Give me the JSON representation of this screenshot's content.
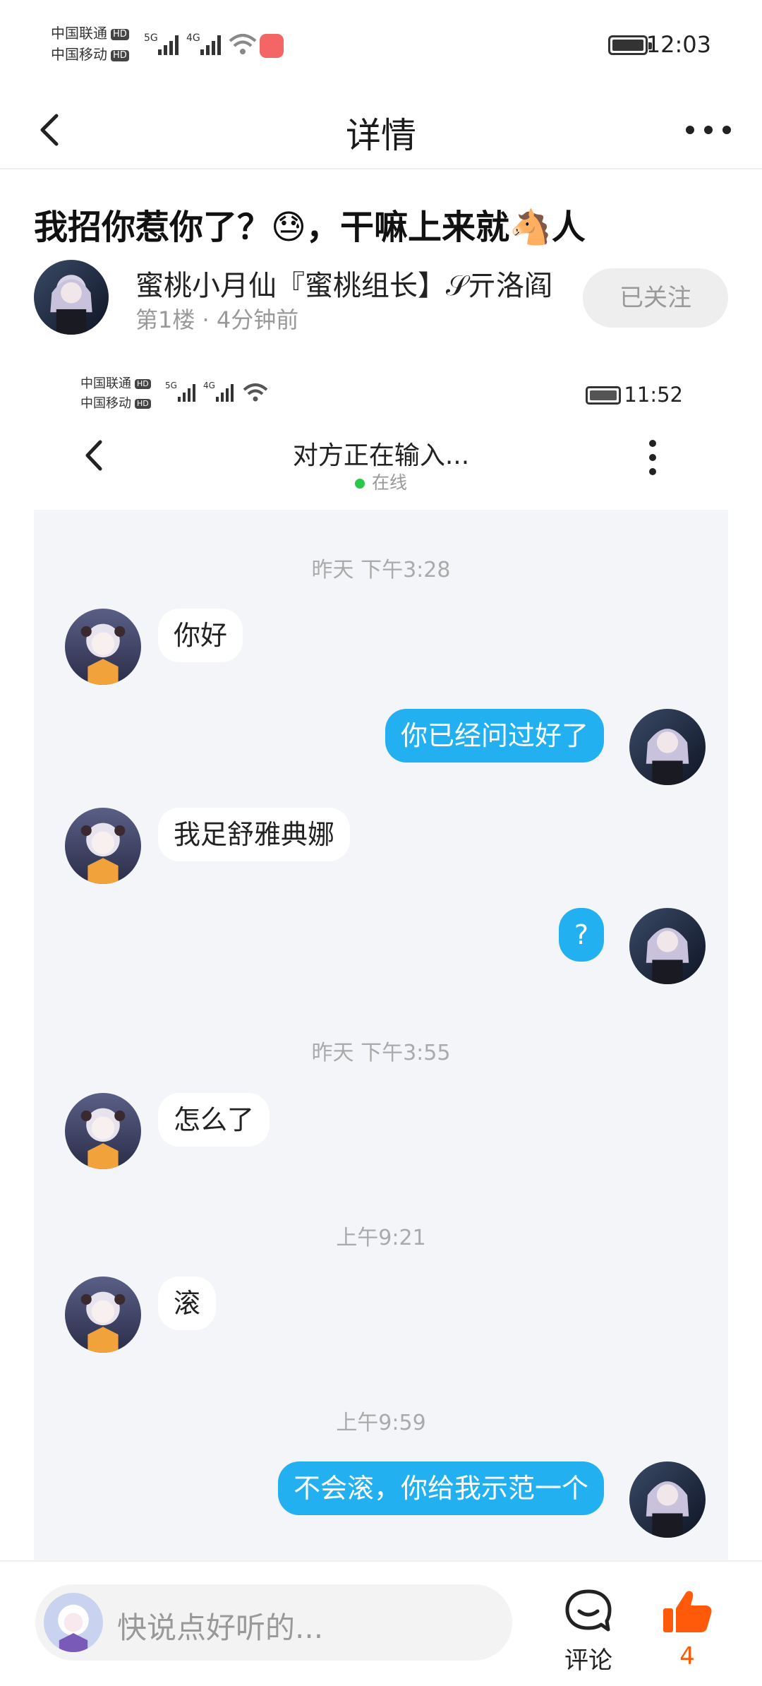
{
  "status_bar": {
    "carrier1": "中国联通",
    "carrier2": "中国移动",
    "hd": "HD",
    "net1": "5G",
    "net2": "4G",
    "time": "12:03"
  },
  "nav": {
    "title": "详情"
  },
  "post": {
    "title": "我招你惹你了？😓，干嘛上来就🐴人",
    "author": "蜜桃小月仙『蜜桃组长】𝒮亓洛阎",
    "meta": "第1楼 · 4分钟前",
    "follow_label": "已关注"
  },
  "embedded": {
    "status_bar": {
      "carrier1": "中国联通",
      "carrier2": "中国移动",
      "hd": "HD",
      "net1": "5G",
      "net2": "4G",
      "time": "11:52"
    },
    "header": {
      "title": "对方正在输入...",
      "status": "在线"
    },
    "timestamps": [
      "昨天 下午3:28",
      "昨天 下午3:55",
      "上午9:21",
      "上午9:59"
    ],
    "messages": [
      {
        "from": "other",
        "text": "你好"
      },
      {
        "from": "me",
        "text": "你已经问过好了"
      },
      {
        "from": "other",
        "text": "我足舒雅典娜"
      },
      {
        "from": "me",
        "text": "?"
      },
      {
        "from": "other",
        "text": "怎么了"
      },
      {
        "from": "other",
        "text": "滚"
      },
      {
        "from": "me",
        "text": "不会滚，你给我示范一个"
      }
    ]
  },
  "bottom": {
    "input_placeholder": "快说点好听的...",
    "comment_label": "评论",
    "like_count": "4"
  },
  "colors": {
    "bubble_out": "#22b0f0",
    "like": "#ff5a0a",
    "online": "#2bc74b"
  }
}
